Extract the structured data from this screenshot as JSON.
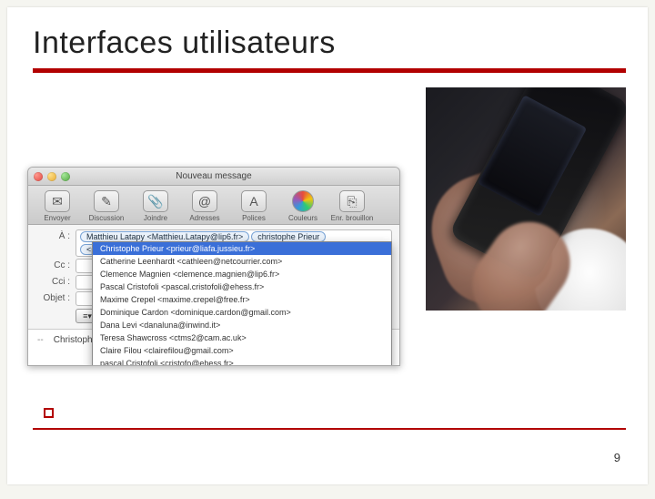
{
  "slide": {
    "title": "Interfaces utilisateurs",
    "page_number": "9"
  },
  "mail": {
    "window_title": "Nouveau message",
    "toolbar": [
      {
        "label": "Envoyer",
        "glyph": "✉"
      },
      {
        "label": "Discussion",
        "glyph": "✎"
      },
      {
        "label": "Joindre",
        "glyph": "📎"
      },
      {
        "label": "Adresses",
        "glyph": "@"
      },
      {
        "label": "Polices",
        "glyph": "A"
      },
      {
        "label": "Couleurs",
        "glyph": "●"
      },
      {
        "label": "Enr. brouillon",
        "glyph": "⎘"
      }
    ],
    "headers": {
      "to_label": "À :",
      "cc_label": "Cc :",
      "bcc_label": "Cci :",
      "subject_label": "Objet :",
      "to_pills": [
        "Matthieu Latapy <Matthieu.Latapy@lip6.fr>",
        "christophe Prieur"
      ],
      "to_continuation": "<prieur@liafa.jussieu.fr>"
    },
    "suggestions": {
      "selected_index": 0,
      "items": [
        "Christophe Prieur <prieur@liafa.jussieu.fr>",
        "Catherine Leenhardt <cathleen@netcourrier.com>",
        "Clemence Magnien <clemence.magnien@lip6.fr>",
        "Pascal Cristofoli <pascal.cristofoli@ehess.fr>",
        "Maxime Crepel <maxime.crepel@free.fr>",
        "Dominique Cardon <dominique.cardon@gmail.com>",
        "Dana Levi <danaluna@inwind.it>",
        "Teresa Shawcross <ctms2@cam.ac.uk>",
        "Claire Filou <clairefilou@gmail.com>",
        "pascal Cristofoli <cristofo@ehess.fr>"
      ]
    },
    "body": {
      "signature_sep": "--",
      "signature_name": "Christophe"
    }
  }
}
